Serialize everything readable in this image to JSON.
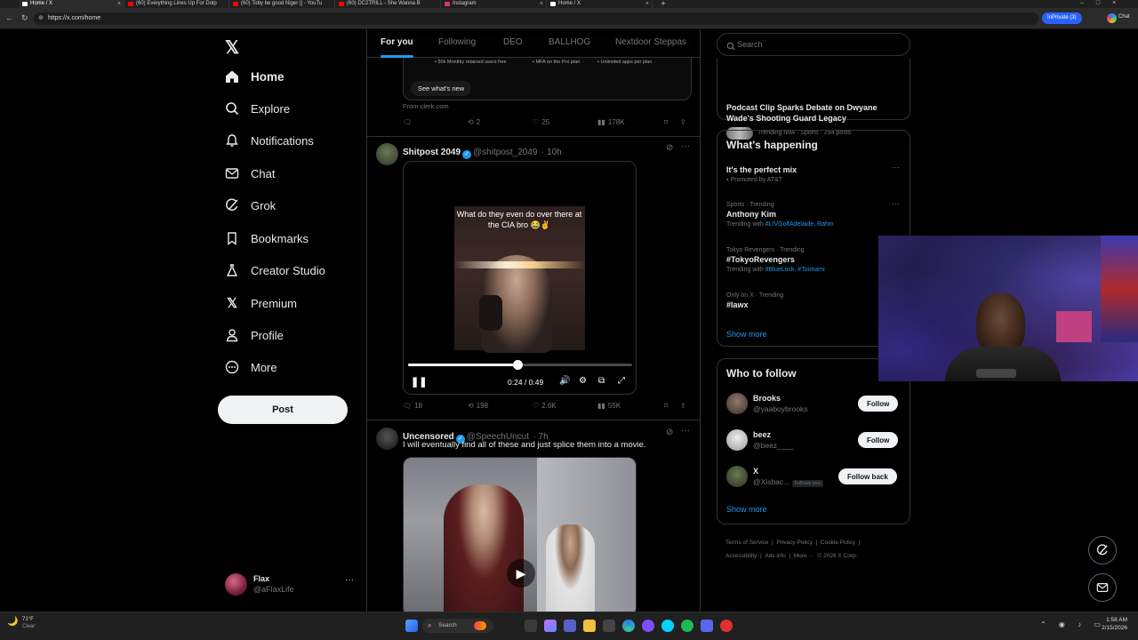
{
  "browser": {
    "tabs": [
      {
        "label": "Home / X",
        "color": "#ffffff"
      },
      {
        "label": "(60) Everything Lines Up For Dolp",
        "color": "#ff0000"
      },
      {
        "label": "(60) Toby be good Niger |] - YouTu",
        "color": "#ff0000"
      },
      {
        "label": "(60) DC2TRILL - She Wanna B",
        "color": "#ff0000"
      },
      {
        "label": "Instagram",
        "color": "#e1306c"
      },
      {
        "label": "Home / X",
        "color": "#ffffff"
      }
    ],
    "url": "https://x.com/home",
    "inprivate_label": "InPrivate (3)",
    "chat_label": "Chat"
  },
  "leftnav": {
    "items": [
      {
        "label": "Home",
        "icon": "home-icon"
      },
      {
        "label": "Explore",
        "icon": "search-icon"
      },
      {
        "label": "Notifications",
        "icon": "bell-icon"
      },
      {
        "label": "Chat",
        "icon": "mail-icon"
      },
      {
        "label": "Grok",
        "icon": "grok-icon"
      },
      {
        "label": "Bookmarks",
        "icon": "bookmark-icon"
      },
      {
        "label": "Creator Studio",
        "icon": "flask-icon"
      },
      {
        "label": "Premium",
        "icon": "x-icon"
      },
      {
        "label": "Profile",
        "icon": "person-icon"
      },
      {
        "label": "More",
        "icon": "more-circle-icon"
      }
    ],
    "post_label": "Post",
    "account": {
      "name": "Flax",
      "handle": "@aFlaxLife"
    }
  },
  "main": {
    "tabs": [
      "For you",
      "Following",
      "DEO",
      "BALLHOG",
      "Nextdoor Steppas"
    ],
    "ad": {
      "features": [
        "50k Monthly retained users free",
        "MFA on the Pro plan",
        "Unlimited apps per plan"
      ],
      "cta": "See what's new",
      "source": "From clerk.com",
      "retweets": "2",
      "likes": "25",
      "views": "178K"
    },
    "tweet1": {
      "name": "Shitpost 2049",
      "handle": "@shitpost_2049",
      "time": "· 10h",
      "caption": "What do they even do over there at the CIA bro 😂✌️",
      "time_display": "0:24 / 0:49",
      "progress": 0.49,
      "replies": "18",
      "retweets": "198",
      "likes": "2.6K",
      "views": "55K"
    },
    "tweet2": {
      "name": "Uncensored",
      "handle": "@SpeechUncut",
      "time": "· 7h",
      "text": "I will eventually find all of these and just splice them into a movie."
    }
  },
  "right": {
    "search_placeholder": "Search",
    "trend_top": {
      "title": "Podcast Clip Sparks Debate on Dwyane Wade's Shooting Guard Legacy",
      "meta": "Trending now · Sports · 294 posts"
    },
    "happening": {
      "title": "What's happening",
      "items": [
        {
          "title": "It's the perfect mix",
          "meta": "Promoted by AT&T"
        },
        {
          "context": "Sports · Trending",
          "title": "Anthony Kim",
          "with_label": "Trending with ",
          "with_tags": "#LIVGolfAdelaide, Rahm"
        },
        {
          "context": "Tokyo Revengers · Trending",
          "title": "#TokyoRevengers",
          "with_label": "Trending with ",
          "with_tags": "#BlueLock, #Toonami"
        },
        {
          "context": "Only on X · Trending",
          "title": "#lawx"
        }
      ],
      "show_more": "Show more"
    },
    "follow": {
      "title": "Who to follow",
      "people": [
        {
          "name": "Brooks",
          "handle": "@yaaboybrooks",
          "button": "Follow"
        },
        {
          "name": "beez",
          "handle": "@beez____",
          "button": "Follow"
        },
        {
          "name": "X",
          "handle": "@Xisbac...",
          "badge": "Follows you",
          "button": "Follow back"
        }
      ],
      "show_more": "Show more"
    },
    "footer": [
      "Terms of Service",
      "|",
      "Privacy Policy",
      "|",
      "Cookie Policy",
      "|",
      "Accessibility",
      "|",
      "Ads info",
      "|",
      "More ···",
      "© 2026 X Corp."
    ]
  },
  "taskbar": {
    "weather_temp": "71°F",
    "weather_cond": "Clear",
    "search": "Search",
    "time": "1:58 AM",
    "date": "2/15/2026"
  },
  "colors": {
    "accent": "#1d9bf0",
    "bg": "#000000",
    "border": "#2f3336",
    "muted": "#71767b"
  }
}
